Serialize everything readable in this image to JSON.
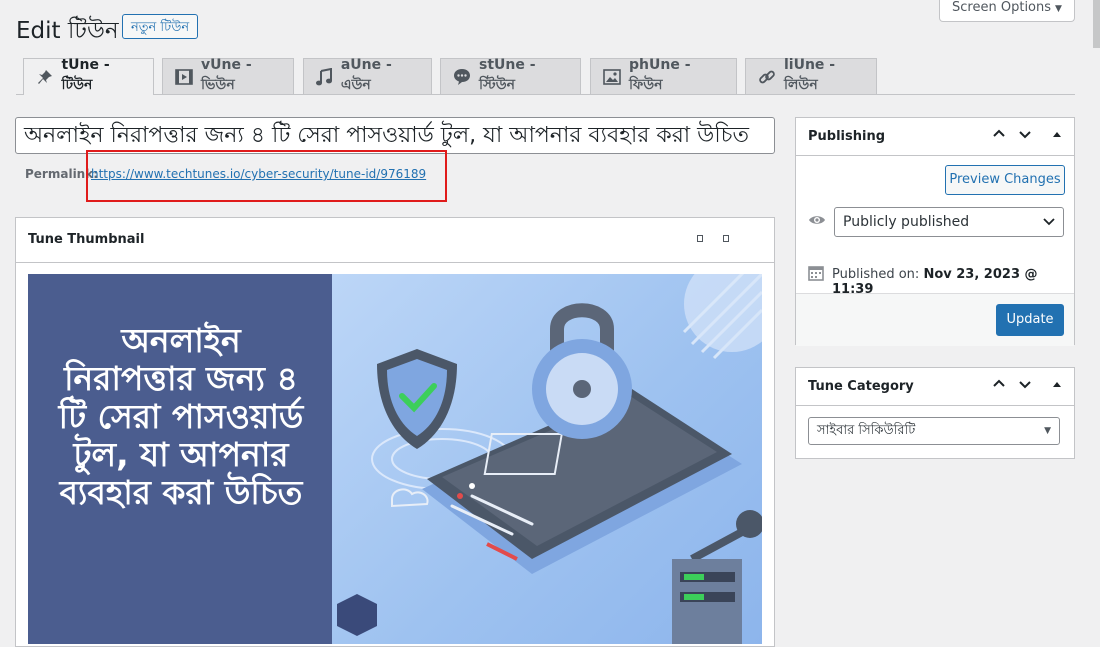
{
  "header": {
    "title": "Edit টিউন",
    "new_button": "নতুন টিউন",
    "screen_options": "Screen Options"
  },
  "tabs": [
    {
      "label": "tUne - টিউন",
      "icon": "pin-icon"
    },
    {
      "label": "vUne - ভিউন",
      "icon": "video-icon"
    },
    {
      "label": "aUne - এউন",
      "icon": "music-icon"
    },
    {
      "label": "stUne - স্টিউন",
      "icon": "chat-icon"
    },
    {
      "label": "phUne - ফিউন",
      "icon": "image-icon"
    },
    {
      "label": "liUne - লিউন",
      "icon": "link-icon"
    }
  ],
  "post": {
    "title_value": "অনলাইন নিরাপত্তার জন্য ৪ টি সেরা পাসওয়ার্ড টুল, যা আপনার ব্যবহার করা উচিত",
    "permalink_label": "Permalink:",
    "permalink_url": "https://www.techtunes.io/cyber-security/tune-id/976189"
  },
  "thumbnail_panel": {
    "title": "Tune Thumbnail",
    "image_text": "অনলাইন\nনিরাপত্তার জন্য ৪\nটি সেরা পাসওয়ার্ড\nটুল, যা আপনার\nব্যবহার করা উচিত"
  },
  "publishing": {
    "title": "Publishing",
    "preview_button": "Preview Changes",
    "visibility_value": "Publicly published",
    "published_label": "Published on:",
    "published_date": "Nov 23, 2023 @ 11:39",
    "update_button": "Update"
  },
  "category": {
    "title": "Tune Category",
    "selected": "সাইবার সিকিউরিটি"
  },
  "colors": {
    "accent": "#2271b1",
    "highlight": "#e01b1b",
    "thumb_left": "#4b5d8f",
    "thumb_right": "#9ec2f0"
  }
}
